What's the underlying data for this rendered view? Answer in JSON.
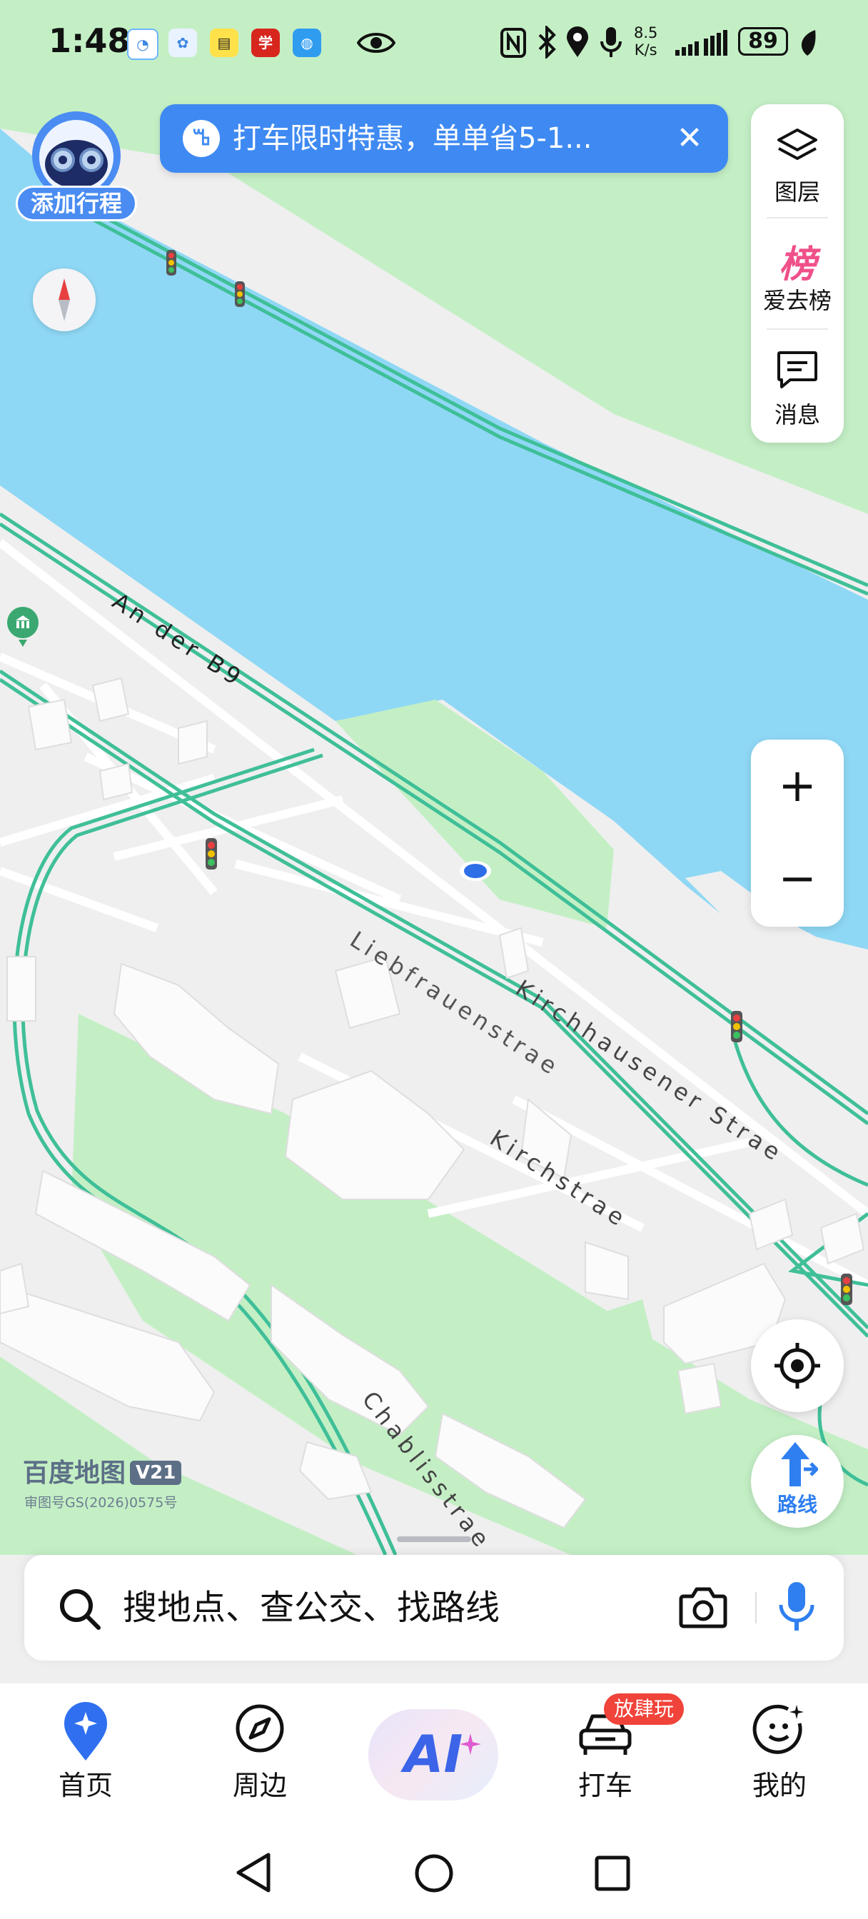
{
  "status_bar": {
    "time": "1:48",
    "net_speed_value": "8.5",
    "net_speed_unit": "K/s",
    "battery": "89",
    "app_icons": [
      "photo-app",
      "community-app",
      "note-app",
      "study-app",
      "compass-app"
    ]
  },
  "promo": {
    "text": "打车限时特惠，单单省5-1...",
    "logo_glyph": "ꕰ"
  },
  "assistant": {
    "label": "添加行程"
  },
  "tools": {
    "layers_label": "图层",
    "ranking_glyph": "榜",
    "ranking_label": "爱去榜",
    "messages_label": "消息"
  },
  "zoom": {
    "in": "+",
    "out": "−"
  },
  "route": {
    "label": "路线"
  },
  "map": {
    "street_labels": {
      "an_der_b9": "An der B9",
      "liebfrauenstrae": "Liebfrauenstrae",
      "kirchhausener": "Kirchhausener Strae",
      "kirchstrae": "Kirchstrae",
      "chablisstrae": "Chablisstrae"
    },
    "colors": {
      "water": "#8fd8f5",
      "green": "#c4efc5",
      "land": "#efefef",
      "road": "#3fbf98",
      "building": "#fbfbfb"
    }
  },
  "brand": {
    "name": "百度地图",
    "version": "V21",
    "approval": "审图号GS(2026)0575号"
  },
  "search": {
    "placeholder": "搜地点、查公交、找路线"
  },
  "nav": {
    "home": "首页",
    "nearby": "周边",
    "ai": "AI",
    "taxi": "打车",
    "taxi_badge": "放肆玩",
    "mine": "我的"
  }
}
